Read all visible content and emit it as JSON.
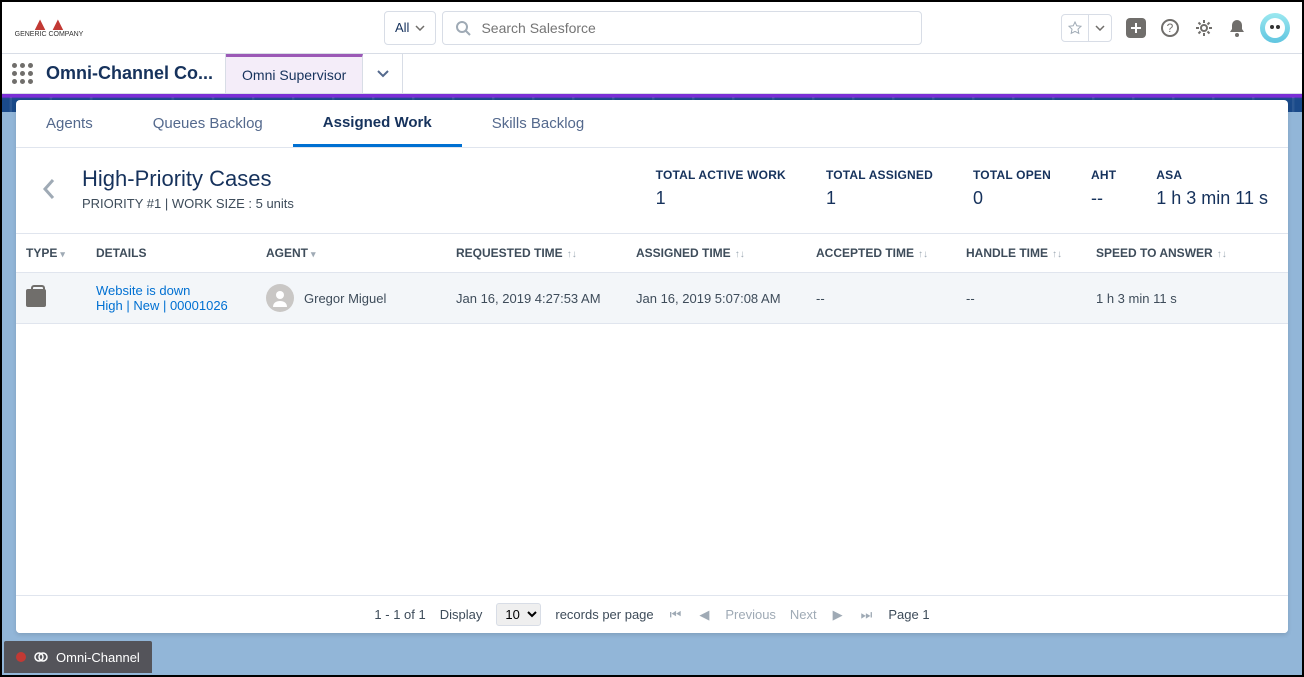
{
  "header": {
    "logo_text": "GENERIC COMPANY",
    "search_scope": "All",
    "search_placeholder": "Search Salesforce"
  },
  "appbar": {
    "app_name": "Omni-Channel Co...",
    "tab_label": "Omni Supervisor"
  },
  "subtabs": {
    "agents": "Agents",
    "queues": "Queues Backlog",
    "assigned": "Assigned Work",
    "skills": "Skills Backlog"
  },
  "page": {
    "title": "High-Priority Cases",
    "subtitle": "PRIORITY #1  |  WORK SIZE : 5 units"
  },
  "metrics": [
    {
      "label": "TOTAL ACTIVE WORK",
      "value": "1"
    },
    {
      "label": "TOTAL ASSIGNED",
      "value": "1"
    },
    {
      "label": "TOTAL OPEN",
      "value": "0"
    },
    {
      "label": "AHT",
      "value": "--"
    },
    {
      "label": "ASA",
      "value": "1 h 3 min 11 s"
    }
  ],
  "columns": {
    "type": "TYPE",
    "details": "DETAILS",
    "agent": "AGENT",
    "requested": "REQUESTED TIME",
    "assigned": "ASSIGNED TIME",
    "accepted": "ACCEPTED TIME",
    "handle": "HANDLE TIME",
    "speed": "SPEED TO ANSWER"
  },
  "rows": [
    {
      "details_title": "Website is down",
      "details_sub": "High | New | 00001026",
      "agent": "Gregor Miguel",
      "requested": "Jan 16, 2019 4:27:53 AM",
      "assigned": "Jan 16, 2019 5:07:08 AM",
      "accepted": "--",
      "handle": "--",
      "speed": "1 h 3 min 11 s"
    }
  ],
  "pager": {
    "range": "1 - 1 of 1",
    "display_label": "Display",
    "per_page": "10",
    "rpp_label": "records per page",
    "prev": "Previous",
    "next": "Next",
    "page": "Page 1"
  },
  "footer": {
    "label": "Omni-Channel"
  }
}
